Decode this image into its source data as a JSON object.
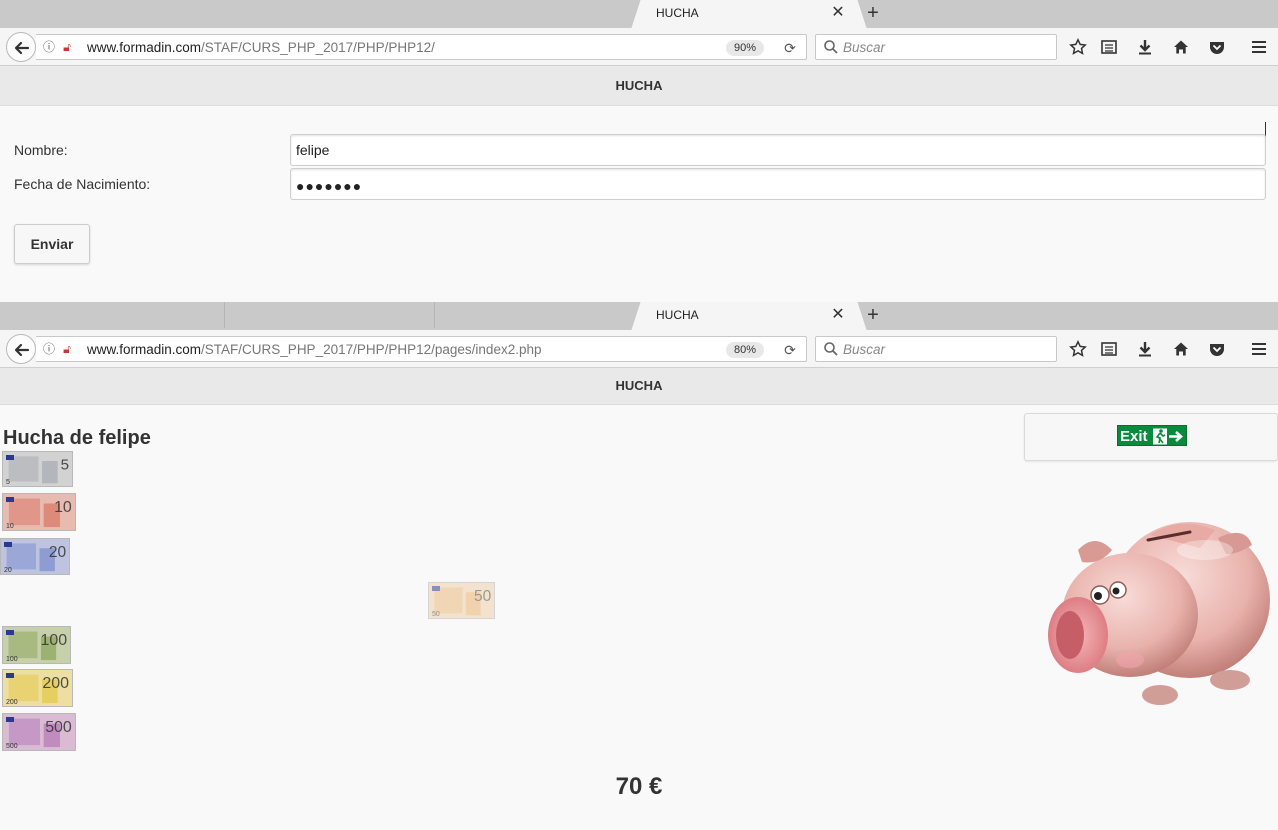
{
  "window1": {
    "tab": {
      "title": "HUCHA",
      "close": "✕",
      "new_tab": "+"
    },
    "address": {
      "host": "www.formadin.com",
      "path": "/STAF/CURS_PHP_2017/PHP/PHP12/",
      "zoom": "90%"
    },
    "search": {
      "placeholder": "Buscar"
    },
    "page": {
      "header": "HUCHA",
      "form": {
        "name_label": "Nombre:",
        "name_value": "felipe",
        "birth_label": "Fecha de Nacimiento:",
        "birth_masked": "●●●●●●●",
        "submit_label": "Enviar"
      }
    }
  },
  "window2": {
    "tab": {
      "title": "HUCHA",
      "close": "✕",
      "new_tab": "+"
    },
    "address": {
      "host": "www.formadin.com",
      "path": "/STAF/CURS_PHP_2017/PHP/PHP12/pages/index2.php",
      "zoom": "80%"
    },
    "search": {
      "placeholder": "Buscar"
    },
    "page": {
      "header": "HUCHA",
      "title": "Hucha de felipe",
      "exit_label": "Exit",
      "banknotes": [
        {
          "value": "5",
          "color": "#a8acb3"
        },
        {
          "value": "10",
          "color": "#d97a6a"
        },
        {
          "value": "20",
          "color": "#7d8fd0"
        },
        {
          "value": "50",
          "color": "#e9a95c"
        },
        {
          "value": "100",
          "color": "#8fa85c"
        },
        {
          "value": "200",
          "color": "#e4c84a"
        },
        {
          "value": "500",
          "color": "#b77bb8"
        }
      ],
      "total": "70 €"
    }
  },
  "icons": [
    "back-arrow-icon",
    "info-icon",
    "insecure-lock-icon",
    "reload-icon",
    "search-icon",
    "star-icon",
    "reading-list-icon",
    "download-icon",
    "home-icon",
    "pocket-icon",
    "menu-icon",
    "exit-sign-icon",
    "piggy-bank-icon"
  ]
}
